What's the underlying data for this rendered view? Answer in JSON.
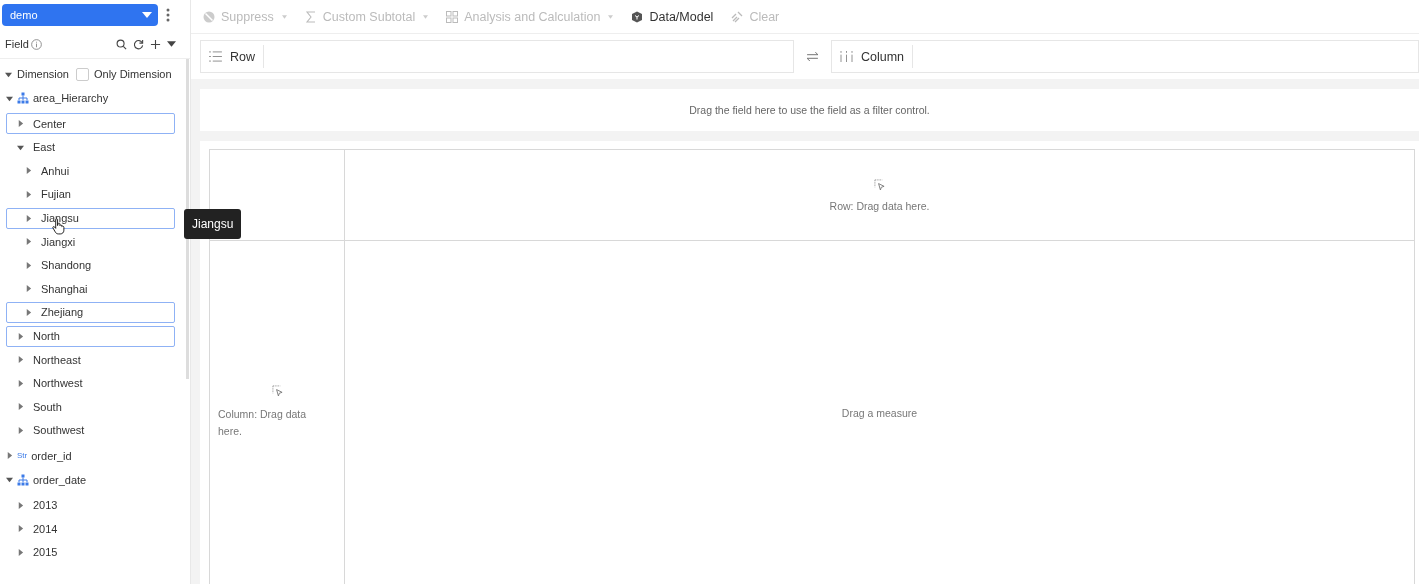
{
  "dataset": {
    "value": "demo"
  },
  "toolbar": [
    {
      "kind": "suppress",
      "label": "Suppress",
      "disabled": true,
      "dropdown": true
    },
    {
      "kind": "sum",
      "label": "Custom Subtotal",
      "disabled": true,
      "dropdown": true
    },
    {
      "kind": "grid",
      "label": "Analysis and Calculation",
      "disabled": true,
      "dropdown": true
    },
    {
      "kind": "cube",
      "label": "Data/Model",
      "disabled": false,
      "dropdown": false
    },
    {
      "kind": "clear",
      "label": "Clear",
      "disabled": true,
      "dropdown": false
    }
  ],
  "field_panel": {
    "title": "Field",
    "dimension": {
      "label": "Dimension",
      "expanded": true,
      "only_dimension": {
        "label": "Only Dimension",
        "checked": false
      }
    },
    "tree": [
      {
        "kind": "hierarchy",
        "label": "area_Hierarchy",
        "expanded": true,
        "children": [
          {
            "label": "Center",
            "expanded": false,
            "selected": true
          },
          {
            "label": "East",
            "expanded": true,
            "selected": false,
            "children": [
              {
                "label": "Anhui",
                "expanded": false,
                "selected": false
              },
              {
                "label": "Fujian",
                "expanded": false,
                "selected": false
              },
              {
                "label": "Jiangsu",
                "expanded": false,
                "selected": true
              },
              {
                "label": "Jiangxi",
                "expanded": false,
                "selected": false
              },
              {
                "label": "Shandong",
                "expanded": false,
                "selected": false
              },
              {
                "label": "Shanghai",
                "expanded": false,
                "selected": false
              },
              {
                "label": "Zhejiang",
                "expanded": false,
                "selected": true
              }
            ]
          },
          {
            "label": "North",
            "expanded": false,
            "selected": true
          },
          {
            "label": "Northeast",
            "expanded": false,
            "selected": false
          },
          {
            "label": "Northwest",
            "expanded": false,
            "selected": false
          },
          {
            "label": "South",
            "expanded": false,
            "selected": false
          },
          {
            "label": "Southwest",
            "expanded": false,
            "selected": false
          }
        ]
      },
      {
        "kind": "string",
        "type_tag": "Str",
        "label": "order_id",
        "expanded": false
      },
      {
        "kind": "hierarchy",
        "label": "order_date",
        "expanded": true,
        "children": [
          {
            "label": "2013",
            "expanded": false,
            "selected": false
          },
          {
            "label": "2014",
            "expanded": false,
            "selected": false
          },
          {
            "label": "2015",
            "expanded": false,
            "selected": false
          }
        ]
      }
    ]
  },
  "tooltip": {
    "text": "Jiangsu"
  },
  "row_shelf": {
    "label": "Row"
  },
  "column_shelf": {
    "label": "Column"
  },
  "filter_area": {
    "text": "Drag the field here to use the field as a filter control."
  },
  "pivot": {
    "row_hint": "Row: Drag data here.",
    "column_hint": "Column: Drag data here.",
    "measure_hint": "Drag a measure"
  }
}
